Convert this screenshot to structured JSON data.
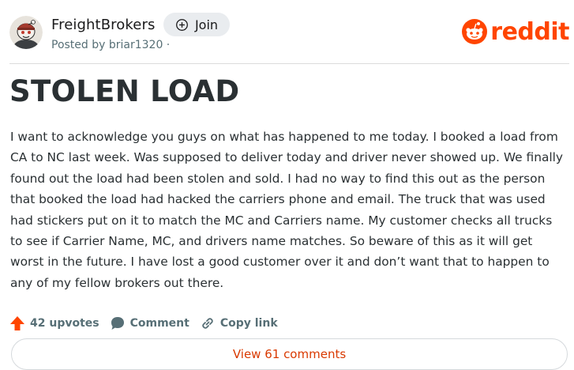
{
  "post": {
    "subreddit": "FreightBrokers",
    "join_label": "Join",
    "posted_by": "Posted by briar1320 ·",
    "title": "STOLEN LOAD",
    "body": "I want to acknowledge you guys on what has happened to me today. I booked a load from CA to NC last week. Was supposed to deliver today and driver never showed up. We finally found out the load had been stolen and sold. I had no way to find this out as the person that booked the load had hacked the carriers phone and email. The truck that was used had stickers put on it to match the MC and Carriers name. My customer checks all trucks to see if Carrier Name, MC, and drivers name matches. So beware of this as it will get worst in the future. I have lost a good customer over it and don’t want that to happen to any of my fellow brokers out there."
  },
  "brand": {
    "logo_text": "reddit",
    "logo_icon": "reddit-snoo-icon",
    "color": "#ff4500"
  },
  "actions": {
    "upvotes": "42 upvotes",
    "comment": "Comment",
    "copy_link": "Copy link",
    "view_comments": "View 61 comments",
    "upvote_icon": "upvote-arrow-icon",
    "comment_icon": "comment-bubble-icon",
    "link_icon": "link-icon"
  },
  "colors": {
    "upvote": "#ff4500",
    "view_comments": "#d93900",
    "meta_text": "#576f76"
  }
}
